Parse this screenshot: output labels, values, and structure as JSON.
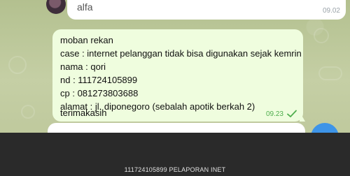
{
  "previous_message": {
    "sender": "alfa",
    "time": "09.02"
  },
  "message": {
    "lines": [
      "moban rekan",
      "case : internet pelanggan tidak bisa digunakan sejak kemrin",
      "nama : qori",
      "nd : 111724105899",
      "cp : 081273803688",
      "alamat : jl. diponegoro (sebalah apotik berkah 2)",
      "terimakasih"
    ],
    "time": "09.23",
    "status_icon": "check-icon"
  },
  "caption": "111724105899 PELAPORAN INET",
  "colors": {
    "outgoing_bubble": "#effdde",
    "incoming_bubble": "#ffffff",
    "time_green": "#4fae4e",
    "fab_blue": "#3d94e8",
    "panel": "#2a2a2a"
  }
}
